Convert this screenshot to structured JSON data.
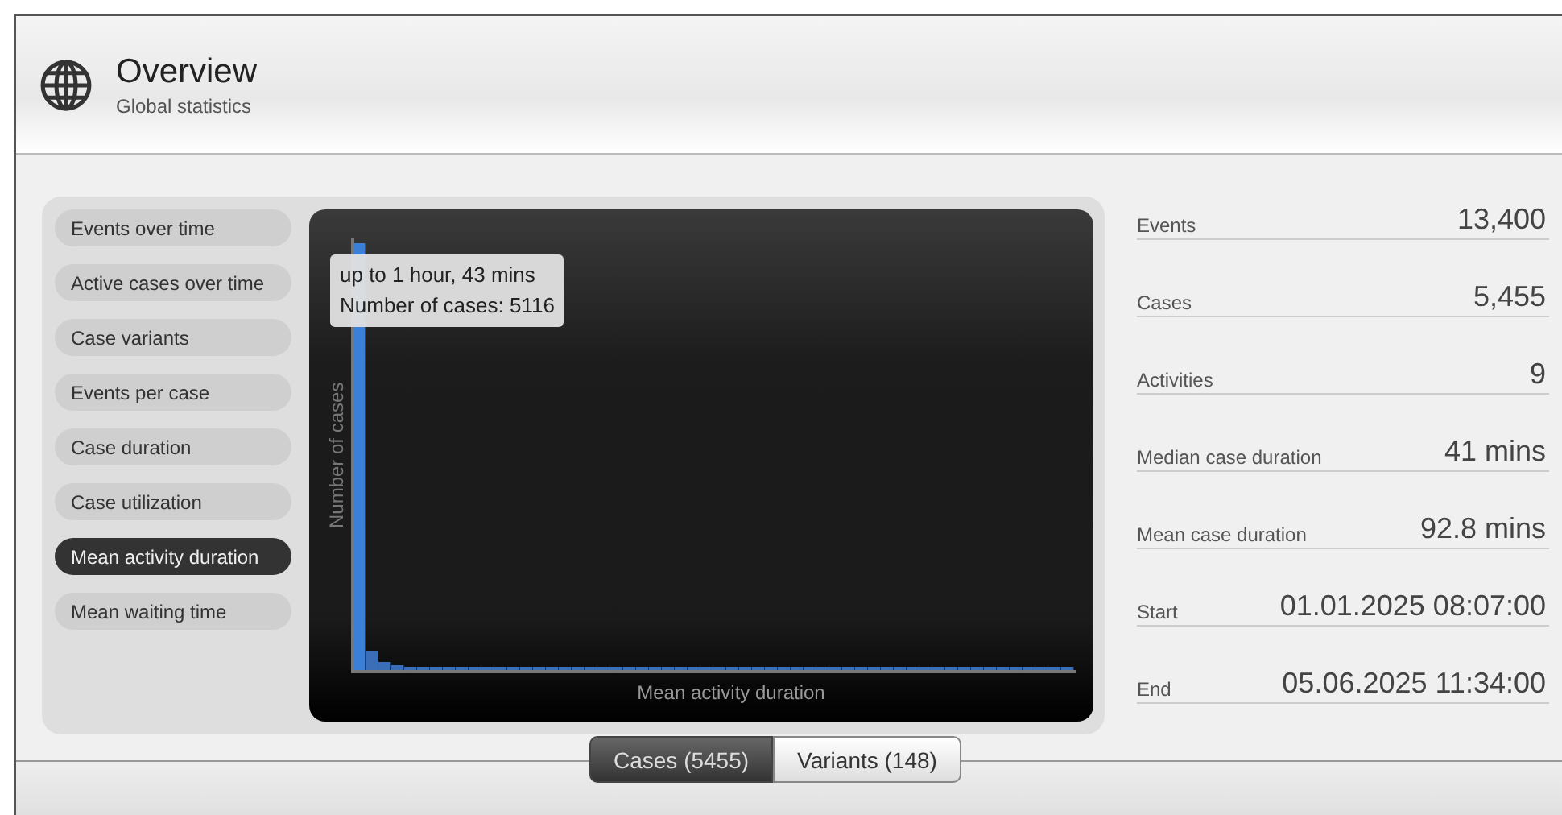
{
  "header": {
    "title": "Overview",
    "subtitle": "Global statistics"
  },
  "menu": [
    {
      "label": "Events over time",
      "selected": false
    },
    {
      "label": "Active cases over time",
      "selected": false
    },
    {
      "label": "Case variants",
      "selected": false
    },
    {
      "label": "Events per case",
      "selected": false
    },
    {
      "label": "Case duration",
      "selected": false
    },
    {
      "label": "Case utilization",
      "selected": false
    },
    {
      "label": "Mean activity duration",
      "selected": true
    },
    {
      "label": "Mean waiting time",
      "selected": false
    }
  ],
  "chart": {
    "ylabel": "Number of cases",
    "xlabel": "Mean activity duration",
    "tooltip": [
      "up to 1 hour, 43 mins",
      "Number of cases: 5116"
    ]
  },
  "stats": [
    {
      "label": "Events",
      "value": "13,400"
    },
    {
      "label": "Cases",
      "value": "5,455"
    },
    {
      "label": "Activities",
      "value": "9"
    },
    {
      "label": "Median case duration",
      "value": "41 mins"
    },
    {
      "label": "Mean case duration",
      "value": "92.8 mins"
    },
    {
      "label": "Start",
      "value": "01.01.2025 08:07:00"
    },
    {
      "label": "End",
      "value": "05.06.2025 11:34:00"
    }
  ],
  "tabs": [
    {
      "label": "Cases (5455)",
      "selected": true
    },
    {
      "label": "Variants (148)",
      "selected": false
    }
  ]
}
